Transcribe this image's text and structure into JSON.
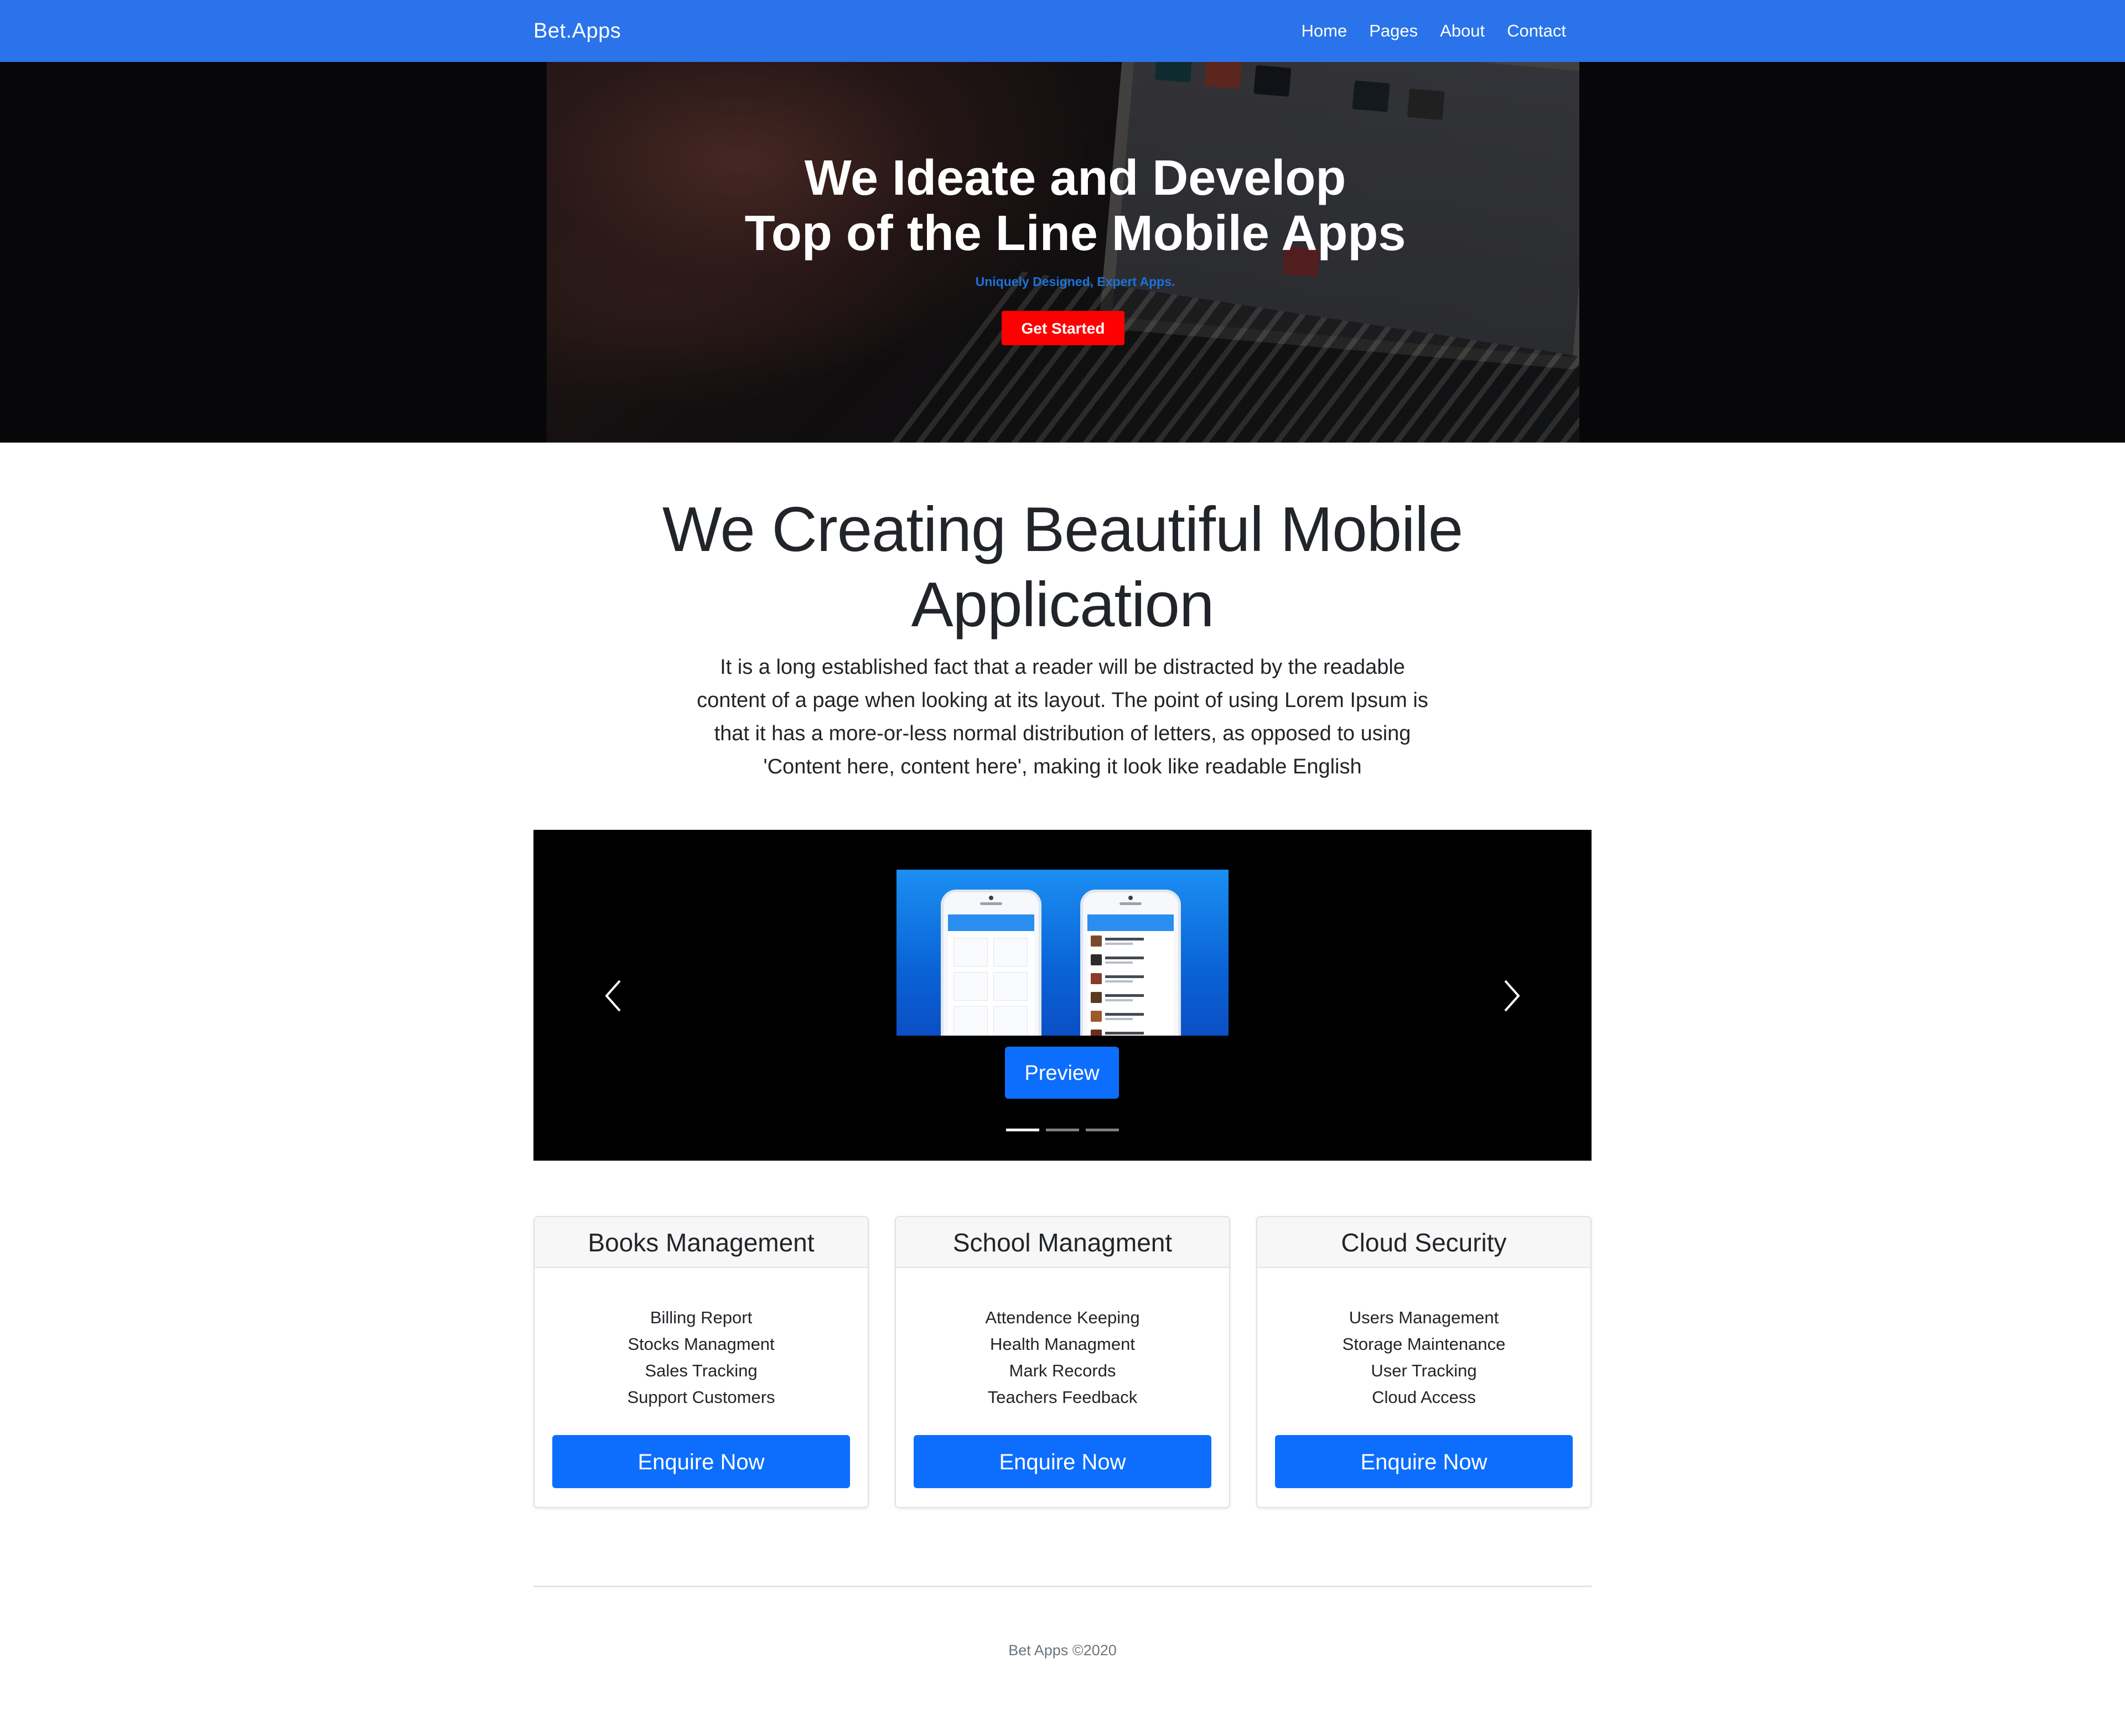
{
  "navbar": {
    "brand": "Bet.Apps",
    "links": [
      "Home",
      "Pages",
      "About",
      "Contact"
    ],
    "background": "#2a73ea"
  },
  "hero": {
    "title_line1": "We Ideate and Develop",
    "title_line2": "Top of the Line Mobile Apps",
    "subtitle": "Uniquely Designed, Expert Apps.",
    "cta_label": "Get Started",
    "cta_color": "#ff0000"
  },
  "intro": {
    "title": "We Creating Beautiful Mobile Application",
    "text": "It is a long established fact that a reader will be distracted by the readable content of a page when looking at its layout. The point of using Lorem Ipsum is that it has a more-or-less normal distribution of letters, as opposed to using 'Content here, content here', making it look like readable English"
  },
  "carousel": {
    "caption_button": "Preview",
    "prev_icon": "chevron-left-icon",
    "next_icon": "chevron-right-icon",
    "slide_count": 3,
    "active_slide": 1
  },
  "cards": [
    {
      "title": "Books Management",
      "items": [
        "Billing Report",
        "Stocks Managment",
        "Sales Tracking",
        "Support Customers"
      ],
      "button": "Enquire Now"
    },
    {
      "title": "School Managment",
      "items": [
        "Attendence Keeping",
        "Health Managment",
        "Mark Records",
        "Teachers Feedback"
      ],
      "button": "Enquire Now"
    },
    {
      "title": "Cloud Security",
      "items": [
        "Users Management",
        "Storage Maintenance",
        "User Tracking",
        "Cloud Access"
      ],
      "button": "Enquire Now"
    }
  ],
  "footer": {
    "text": "Bet Apps ©2020"
  },
  "colors": {
    "primary_button": "#0d6efd",
    "carousel_background": "#000000"
  }
}
